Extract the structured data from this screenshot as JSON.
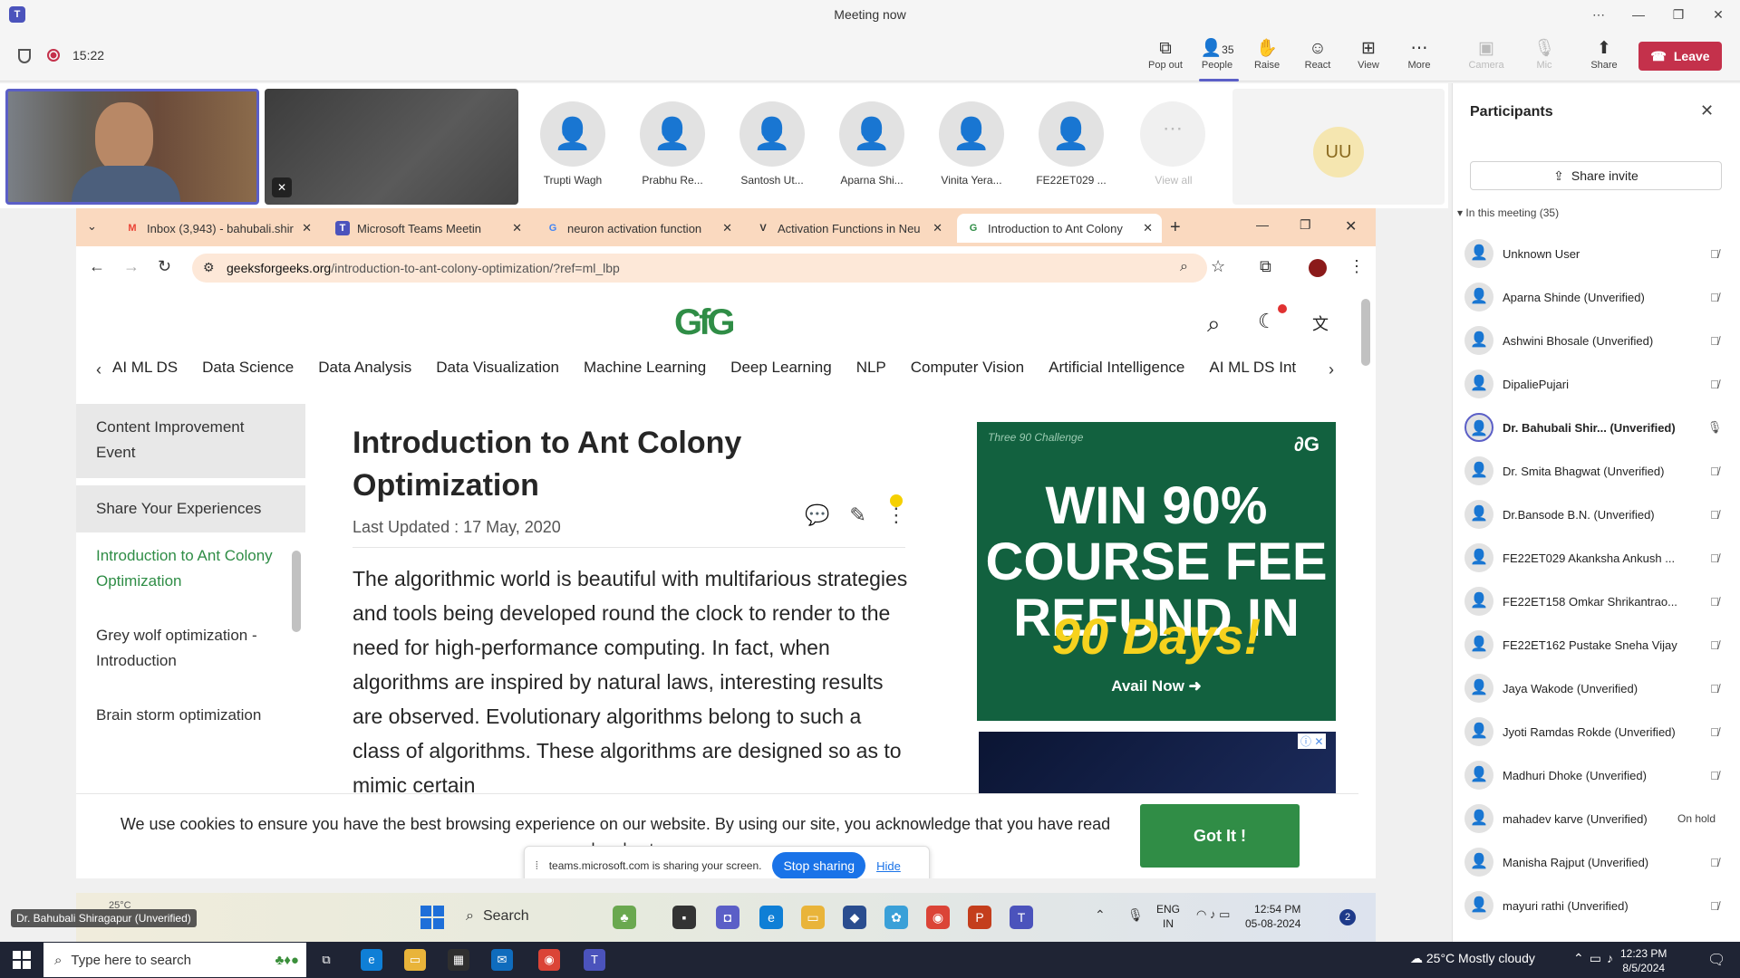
{
  "window": {
    "title": "Meeting now"
  },
  "toolbar": {
    "timer": "15:22",
    "buttons": [
      {
        "label": "Pop out",
        "icon": "pop-out-icon"
      },
      {
        "label": "People",
        "icon": "people-icon",
        "badge": "35"
      },
      {
        "label": "Raise",
        "icon": "raise-hand-icon"
      },
      {
        "label": "React",
        "icon": "react-icon"
      },
      {
        "label": "View",
        "icon": "view-icon"
      },
      {
        "label": "More",
        "icon": "more-icon"
      },
      {
        "label": "Camera",
        "icon": "camera-off-icon"
      },
      {
        "label": "Mic",
        "icon": "mic-off-icon"
      },
      {
        "label": "Share",
        "icon": "share-icon"
      }
    ],
    "leave": "Leave"
  },
  "stage": {
    "tiles": [
      "Trupti Wagh",
      "Prabhu Re...",
      "Santosh Ut...",
      "Aparna Shi...",
      "Vinita Yera...",
      "FE22ET029 ..."
    ],
    "view_all": "View all",
    "uu_initials": "UU"
  },
  "participants": {
    "title": "Participants",
    "share_invite": "Share invite",
    "section": "In this meeting (35)",
    "list": [
      {
        "name": "Unknown User",
        "status": ""
      },
      {
        "name": "Aparna Shinde (Unverified)",
        "status": ""
      },
      {
        "name": "Ashwini Bhosale (Unverified)",
        "status": ""
      },
      {
        "name": "DipaliePujari",
        "status": ""
      },
      {
        "name": "Dr. Bahubali Shir...  (Unverified)",
        "status": ""
      },
      {
        "name": "Dr. Smita Bhagwat (Unverified)",
        "status": ""
      },
      {
        "name": "Dr.Bansode B.N. (Unverified)",
        "status": ""
      },
      {
        "name": "FE22ET029 Akanksha Ankush ...",
        "status": ""
      },
      {
        "name": "FE22ET158 Omkar Shrikantrao...",
        "status": ""
      },
      {
        "name": "FE22ET162 Pustake Sneha Vijay",
        "status": ""
      },
      {
        "name": "Jaya Wakode (Unverified)",
        "status": ""
      },
      {
        "name": "Jyoti Ramdas Rokde (Unverified)",
        "status": ""
      },
      {
        "name": "Madhuri Dhoke (Unverified)",
        "status": ""
      },
      {
        "name": "mahadev karve (Unverified)",
        "status": "On hold"
      },
      {
        "name": "Manisha Rajput (Unverified)",
        "status": ""
      },
      {
        "name": "mayuri rathi (Unverified)",
        "status": ""
      }
    ]
  },
  "browser": {
    "tabs": [
      {
        "title": "Inbox (3,943) - bahubali.shir",
        "fav": "M"
      },
      {
        "title": "Microsoft Teams Meetin",
        "fav": "T"
      },
      {
        "title": "neuron activation function",
        "fav": "G"
      },
      {
        "title": "Activation Functions in Neu",
        "fav": "V"
      },
      {
        "title": "Introduction to Ant Colony",
        "fav": "G"
      }
    ],
    "url_domain": "geeksforgeeks.org",
    "url_path": "/introduction-to-ant-colony-optimization/?ref=ml_lbp"
  },
  "site": {
    "logo": "GfG",
    "nav": [
      "AI ML DS",
      "Data Science",
      "Data Analysis",
      "Data Visualization",
      "Machine Learning",
      "Deep Learning",
      "NLP",
      "Computer Vision",
      "Artificial Intelligence",
      "AI ML DS Int"
    ],
    "sidebar": {
      "box1": "Content Improvement Event",
      "box2": "Share Your Experiences",
      "items": [
        "Introduction to Ant Colony Optimization",
        "Grey wolf optimization - Introduction",
        "Brain storm optimization"
      ]
    },
    "article": {
      "title": "Introduction to Ant Colony Optimization",
      "updated": "Last Updated : 17 May, 2020",
      "body": "The algorithmic world is beautiful with multifarious strategies and tools being developed round the clock to render to the need for high-performance computing. In fact, when algorithms are inspired by natural laws, interesting results are observed. Evolutionary algorithms belong to such a class of algorithms. These algorithms are designed so as to mimic certain"
    },
    "ad": {
      "badge": "Three 90 Challenge",
      "headline": "WIN 90% COURSE FEE REFUND IN",
      "days": "90 Days!",
      "cta": "Avail Now"
    },
    "cookie": {
      "text": "We use cookies to ensure you have the best browsing experience on our website. By using our site, you acknowledge that you have read and understo",
      "button": "Got It !"
    }
  },
  "sharebar": {
    "text": "teams.microsoft.com is sharing your screen.",
    "stop": "Stop sharing",
    "hide": "Hide"
  },
  "inner_taskbar": {
    "search": "Search",
    "lang": "ENG",
    "region": "IN",
    "time": "12:54 PM",
    "date": "05-08-2024",
    "weather": "25°C",
    "badge": "2"
  },
  "name_tag": "Dr. Bahubali Shiragapur (Unverified)",
  "taskbar": {
    "search_placeholder": "Type here to search",
    "weather": "25°C  Mostly cloudy",
    "time": "12:23 PM",
    "date": "8/5/2024"
  }
}
